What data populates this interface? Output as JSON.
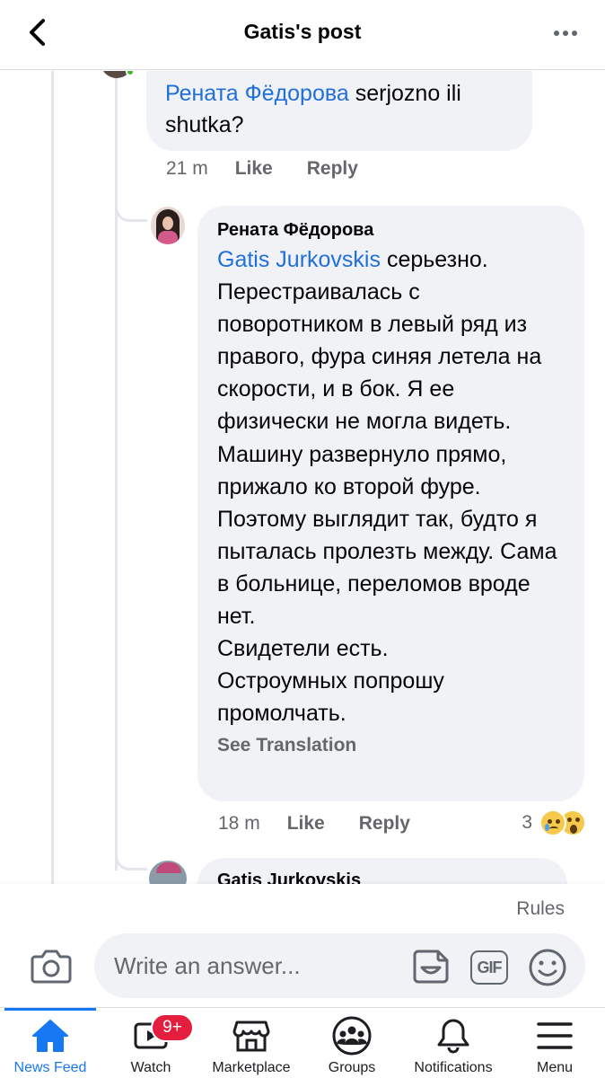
{
  "header": {
    "title": "Gatis's post"
  },
  "comments": [
    {
      "mention": "Рената Фёдорова",
      "text": "serjozno ili shutka?",
      "time": "21 m",
      "like_label": "Like",
      "reply_label": "Reply"
    },
    {
      "author": "Рената Фёдорова",
      "mention": "Gatis Jurkovskis",
      "text": "серьезно. Перестраивалась с поворотником в левый ряд из правого, фура синяя летела на скорости, и в бок. Я ее физически не могла видеть. Машину развернуло прямо, прижало ко второй фуре. Поэтому выглядит так, будто я пыталась пролезть между. Сама в больнице, переломов вроде нет.\nСвидетели есть.\nОстроумных попрошу промолчать.",
      "see_translation": "See Translation",
      "time": "18 m",
      "like_label": "Like",
      "reply_label": "Reply",
      "reaction_count": "3",
      "reactions": [
        "sad-reaction",
        "wow-reaction"
      ]
    },
    {
      "author": "Gatis Jurkovskis"
    }
  ],
  "composer": {
    "rules_label": "Rules",
    "placeholder": "Write an answer...",
    "gif_label": "GIF"
  },
  "tabbar": {
    "badge": "9+",
    "tabs": [
      {
        "label": "News Feed",
        "icon": "home-icon",
        "active": true
      },
      {
        "label": "Watch",
        "icon": "watch-icon"
      },
      {
        "label": "Marketplace",
        "icon": "marketplace-icon"
      },
      {
        "label": "Groups",
        "icon": "groups-icon"
      },
      {
        "label": "Notifications",
        "icon": "bell-icon"
      },
      {
        "label": "Menu",
        "icon": "menu-icon"
      }
    ]
  },
  "colors": {
    "accent": "#1877f2",
    "mention": "#216fdb",
    "bubble": "#f0f2f5",
    "secondary_text": "#65676b",
    "badge": "#e41e3f"
  }
}
